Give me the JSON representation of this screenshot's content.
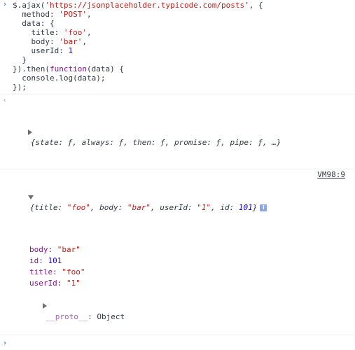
{
  "console": {
    "input_lines": [
      [
        {
          "t": "$.ajax(",
          "c": "plain"
        },
        {
          "t": "'https://jsonplaceholder.typicode.com/posts'",
          "c": "str"
        },
        {
          "t": ", {",
          "c": "plain"
        }
      ],
      [
        {
          "t": "  method: ",
          "c": "plain"
        },
        {
          "t": "'POST'",
          "c": "str"
        },
        {
          "t": ",",
          "c": "plain"
        }
      ],
      [
        {
          "t": "  data: {",
          "c": "plain"
        }
      ],
      [
        {
          "t": "    title: ",
          "c": "plain"
        },
        {
          "t": "'foo'",
          "c": "str"
        },
        {
          "t": ",",
          "c": "plain"
        }
      ],
      [
        {
          "t": "    body: ",
          "c": "plain"
        },
        {
          "t": "'bar'",
          "c": "str"
        },
        {
          "t": ",",
          "c": "plain"
        }
      ],
      [
        {
          "t": "    userId: ",
          "c": "plain"
        },
        {
          "t": "1",
          "c": "num"
        }
      ],
      [
        {
          "t": "  }",
          "c": "plain"
        }
      ],
      [
        {
          "t": "}).then(",
          "c": "plain"
        },
        {
          "t": "function",
          "c": "kw"
        },
        {
          "t": "(data) {",
          "c": "plain"
        }
      ],
      [
        {
          "t": "  console.log(data);",
          "c": "plain"
        }
      ],
      [
        {
          "t": "});",
          "c": "plain"
        }
      ]
    ],
    "return_value": "{state: ƒ, always: ƒ, then: ƒ, promise: ƒ, pipe: ƒ, …}",
    "log_message": {
      "summary_parts": [
        {
          "t": "{",
          "c": "plain"
        },
        {
          "t": "title",
          "c": "plain"
        },
        {
          "t": ": ",
          "c": "plain"
        },
        {
          "t": "\"foo\"",
          "c": "str"
        },
        {
          "t": ", ",
          "c": "plain"
        },
        {
          "t": "body",
          "c": "plain"
        },
        {
          "t": ": ",
          "c": "plain"
        },
        {
          "t": "\"bar\"",
          "c": "str"
        },
        {
          "t": ", ",
          "c": "plain"
        },
        {
          "t": "userId",
          "c": "plain"
        },
        {
          "t": ": ",
          "c": "plain"
        },
        {
          "t": "\"1\"",
          "c": "str"
        },
        {
          "t": ", ",
          "c": "plain"
        },
        {
          "t": "id",
          "c": "plain"
        },
        {
          "t": ": ",
          "c": "plain"
        },
        {
          "t": "101",
          "c": "num"
        },
        {
          "t": "}",
          "c": "plain"
        }
      ],
      "info_icon_label": "i",
      "source": "VM98:9",
      "properties": [
        {
          "key": "body",
          "value": "\"bar\"",
          "vc": "str"
        },
        {
          "key": "id",
          "value": "101",
          "vc": "num"
        },
        {
          "key": "title",
          "value": "\"foo\"",
          "vc": "str"
        },
        {
          "key": "userId",
          "value": "\"1\"",
          "vc": "str"
        }
      ],
      "proto": {
        "key": "__proto__",
        "value": "Object"
      }
    },
    "colors": {
      "string": "#c41a16",
      "number": "#1c00cf",
      "keyword": "#881391",
      "prompt": "#367cf1"
    },
    "icons": {
      "input_prompt": "chevron-right-icon",
      "expand": "triangle-right-icon",
      "collapse": "triangle-down-icon",
      "info": "info-icon"
    }
  }
}
